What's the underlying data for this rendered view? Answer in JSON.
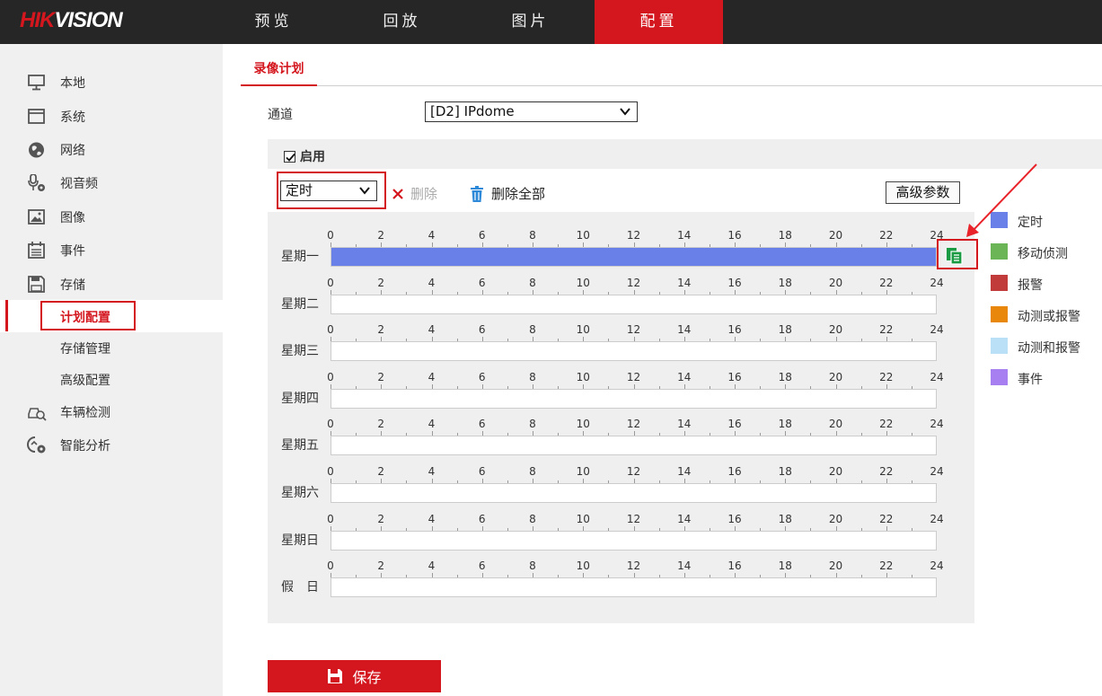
{
  "brand": {
    "part1": "HIK",
    "part2": "VISION",
    "accent": "#d4171e"
  },
  "topnav": [
    {
      "label": "预览",
      "active": false
    },
    {
      "label": "回放",
      "active": false
    },
    {
      "label": "图片",
      "active": false
    },
    {
      "label": "配置",
      "active": true
    }
  ],
  "sidebar": {
    "items": [
      {
        "label": "本地",
        "icon": "monitor-icon"
      },
      {
        "label": "系统",
        "icon": "window-icon"
      },
      {
        "label": "网络",
        "icon": "globe-icon"
      },
      {
        "label": "视音频",
        "icon": "microphone-camera-icon"
      },
      {
        "label": "图像",
        "icon": "image-icon"
      },
      {
        "label": "事件",
        "icon": "calendar-icon"
      },
      {
        "label": "存储",
        "icon": "floppy-disk-icon"
      }
    ],
    "sub_items": [
      {
        "label": "计划配置",
        "current": true
      },
      {
        "label": "存储管理",
        "current": false
      },
      {
        "label": "高级配置",
        "current": false
      }
    ],
    "items_after": [
      {
        "label": "车辆检测",
        "icon": "vehicle-search-icon"
      },
      {
        "label": "智能分析",
        "icon": "smart-analysis-icon"
      }
    ]
  },
  "tab": {
    "label": "录像计划"
  },
  "channel": {
    "label": "通道",
    "value": "[D2] IPdome"
  },
  "enable": {
    "label": "启用",
    "checked": true
  },
  "toolbar": {
    "type_value": "定时",
    "delete_label": "删除",
    "delete_all_label": "删除全部",
    "advanced_label": "高级参数"
  },
  "schedule": {
    "ticks": [
      "0",
      "2",
      "4",
      "6",
      "8",
      "10",
      "12",
      "14",
      "16",
      "18",
      "20",
      "22",
      "24"
    ],
    "days": [
      {
        "name": "星期一",
        "segments": [
          {
            "start": 0,
            "end": 24,
            "type": "定时"
          }
        ]
      },
      {
        "name": "星期二",
        "segments": []
      },
      {
        "name": "星期三",
        "segments": []
      },
      {
        "name": "星期四",
        "segments": []
      },
      {
        "name": "星期五",
        "segments": []
      },
      {
        "name": "星期六",
        "segments": []
      },
      {
        "name": "星期日",
        "segments": []
      },
      {
        "name": "假　日",
        "segments": []
      }
    ]
  },
  "legend": [
    {
      "label": "定时",
      "color": "#6a80e9"
    },
    {
      "label": "移动侦测",
      "color": "#6cb557"
    },
    {
      "label": "报警",
      "color": "#c23b3b"
    },
    {
      "label": "动测或报警",
      "color": "#e8870a"
    },
    {
      "label": "动测和报警",
      "color": "#b9e0f7"
    },
    {
      "label": "事件",
      "color": "#a77ff0"
    }
  ],
  "save": {
    "label": "保存"
  }
}
